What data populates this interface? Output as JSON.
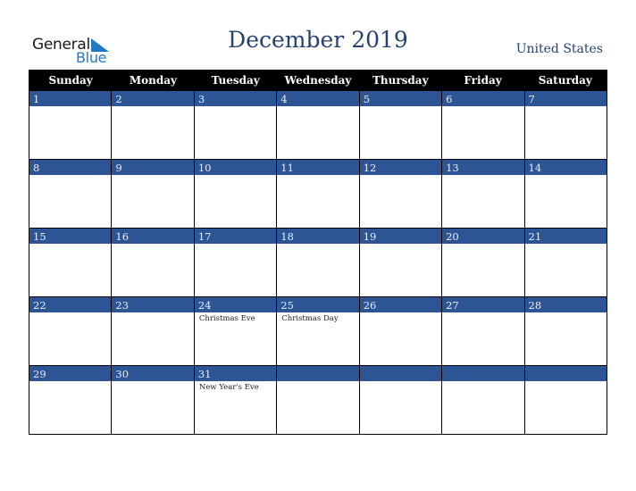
{
  "brand": {
    "line1": "General",
    "line2": "Blue",
    "accent_color": "#1f78c1"
  },
  "header": {
    "title": "December 2019",
    "country": "United States"
  },
  "colors": {
    "band": "#2d5596",
    "title": "#26416e",
    "header_bg": "#000000"
  },
  "days_of_week": [
    "Sunday",
    "Monday",
    "Tuesday",
    "Wednesday",
    "Thursday",
    "Friday",
    "Saturday"
  ],
  "weeks": [
    [
      {
        "day": "1",
        "holiday": ""
      },
      {
        "day": "2",
        "holiday": ""
      },
      {
        "day": "3",
        "holiday": ""
      },
      {
        "day": "4",
        "holiday": ""
      },
      {
        "day": "5",
        "holiday": ""
      },
      {
        "day": "6",
        "holiday": ""
      },
      {
        "day": "7",
        "holiday": ""
      }
    ],
    [
      {
        "day": "8",
        "holiday": ""
      },
      {
        "day": "9",
        "holiday": ""
      },
      {
        "day": "10",
        "holiday": ""
      },
      {
        "day": "11",
        "holiday": ""
      },
      {
        "day": "12",
        "holiday": ""
      },
      {
        "day": "13",
        "holiday": ""
      },
      {
        "day": "14",
        "holiday": ""
      }
    ],
    [
      {
        "day": "15",
        "holiday": ""
      },
      {
        "day": "16",
        "holiday": ""
      },
      {
        "day": "17",
        "holiday": ""
      },
      {
        "day": "18",
        "holiday": ""
      },
      {
        "day": "19",
        "holiday": ""
      },
      {
        "day": "20",
        "holiday": ""
      },
      {
        "day": "21",
        "holiday": ""
      }
    ],
    [
      {
        "day": "22",
        "holiday": ""
      },
      {
        "day": "23",
        "holiday": ""
      },
      {
        "day": "24",
        "holiday": "Christmas Eve"
      },
      {
        "day": "25",
        "holiday": "Christmas Day"
      },
      {
        "day": "26",
        "holiday": ""
      },
      {
        "day": "27",
        "holiday": ""
      },
      {
        "day": "28",
        "holiday": ""
      }
    ],
    [
      {
        "day": "29",
        "holiday": ""
      },
      {
        "day": "30",
        "holiday": ""
      },
      {
        "day": "31",
        "holiday": "New Year's Eve"
      },
      {
        "day": "",
        "holiday": ""
      },
      {
        "day": "",
        "holiday": ""
      },
      {
        "day": "",
        "holiday": ""
      },
      {
        "day": "",
        "holiday": ""
      }
    ]
  ]
}
